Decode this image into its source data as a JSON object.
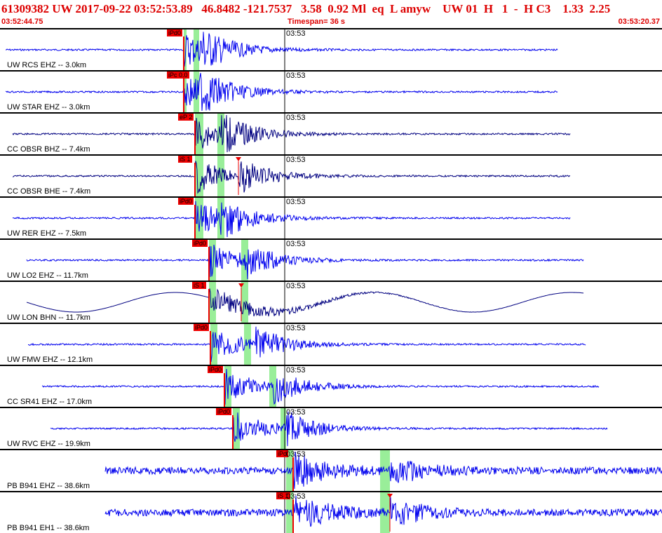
{
  "header": {
    "title": "61309382 UW 2017-09-22 03:52:53.89   46.8482 -121.7537   3.58  0.92 Ml  eq  L amyw    UW 01  H   1  -  H C3    1.33  2.25",
    "start_time": "03:52:44.75",
    "timespan": "Timespan=  36 s",
    "end_time": "03:53:20.37"
  },
  "colors": {
    "header_text": "#dd0000",
    "pick_box": "#ee0000",
    "pick_line": "#ee0000",
    "window_band": "#99ee99",
    "trace_bright": "#0000ff",
    "trace_dark": "#000080"
  },
  "minute_label": "03:53",
  "panels": [
    {
      "channel": "UW RCS EHZ -- 3.0km",
      "pick": "iPd0",
      "color": "#0000ee",
      "style": "burst"
    },
    {
      "channel": "UW STAR EHZ -- 3.0km",
      "pick": "iPc 0.0",
      "color": "#0000ee",
      "style": "burst"
    },
    {
      "channel": "CC OBSR BHZ -- 7.4km",
      "pick": "eP 2",
      "color": "#000080",
      "style": "burst"
    },
    {
      "channel": "CC OBSR BHE -- 7.4km",
      "pick": "iS 1",
      "color": "#000080",
      "style": "burst"
    },
    {
      "channel": "UW RER EHZ -- 7.5km",
      "pick": "iPd0",
      "color": "#0000ee",
      "style": "burst"
    },
    {
      "channel": "UW LO2 EHZ -- 11.7km",
      "pick": "iPd0",
      "color": "#0000ee",
      "style": "burst"
    },
    {
      "channel": "UW LON BHN -- 11.7km",
      "pick": "iS 1",
      "color": "#000080",
      "style": "wave"
    },
    {
      "channel": "UW FMW EHZ -- 12.1km",
      "pick": "iPd0",
      "color": "#0000ee",
      "style": "burst"
    },
    {
      "channel": "CC SR41 EHZ -- 17.0km",
      "pick": "iPd0",
      "color": "#0000ee",
      "style": "burst"
    },
    {
      "channel": "UW RVC EHZ -- 19.9km",
      "pick": "iPd0",
      "color": "#0000ee",
      "style": "burst"
    },
    {
      "channel": "PB B941 EHZ -- 38.6km",
      "pick": "iPd",
      "color": "#0000ee",
      "style": "noisy"
    },
    {
      "channel": "PB B941 EH1 -- 38.6km",
      "pick": "iS 1",
      "color": "#0000ee",
      "style": "noisy"
    }
  ]
}
